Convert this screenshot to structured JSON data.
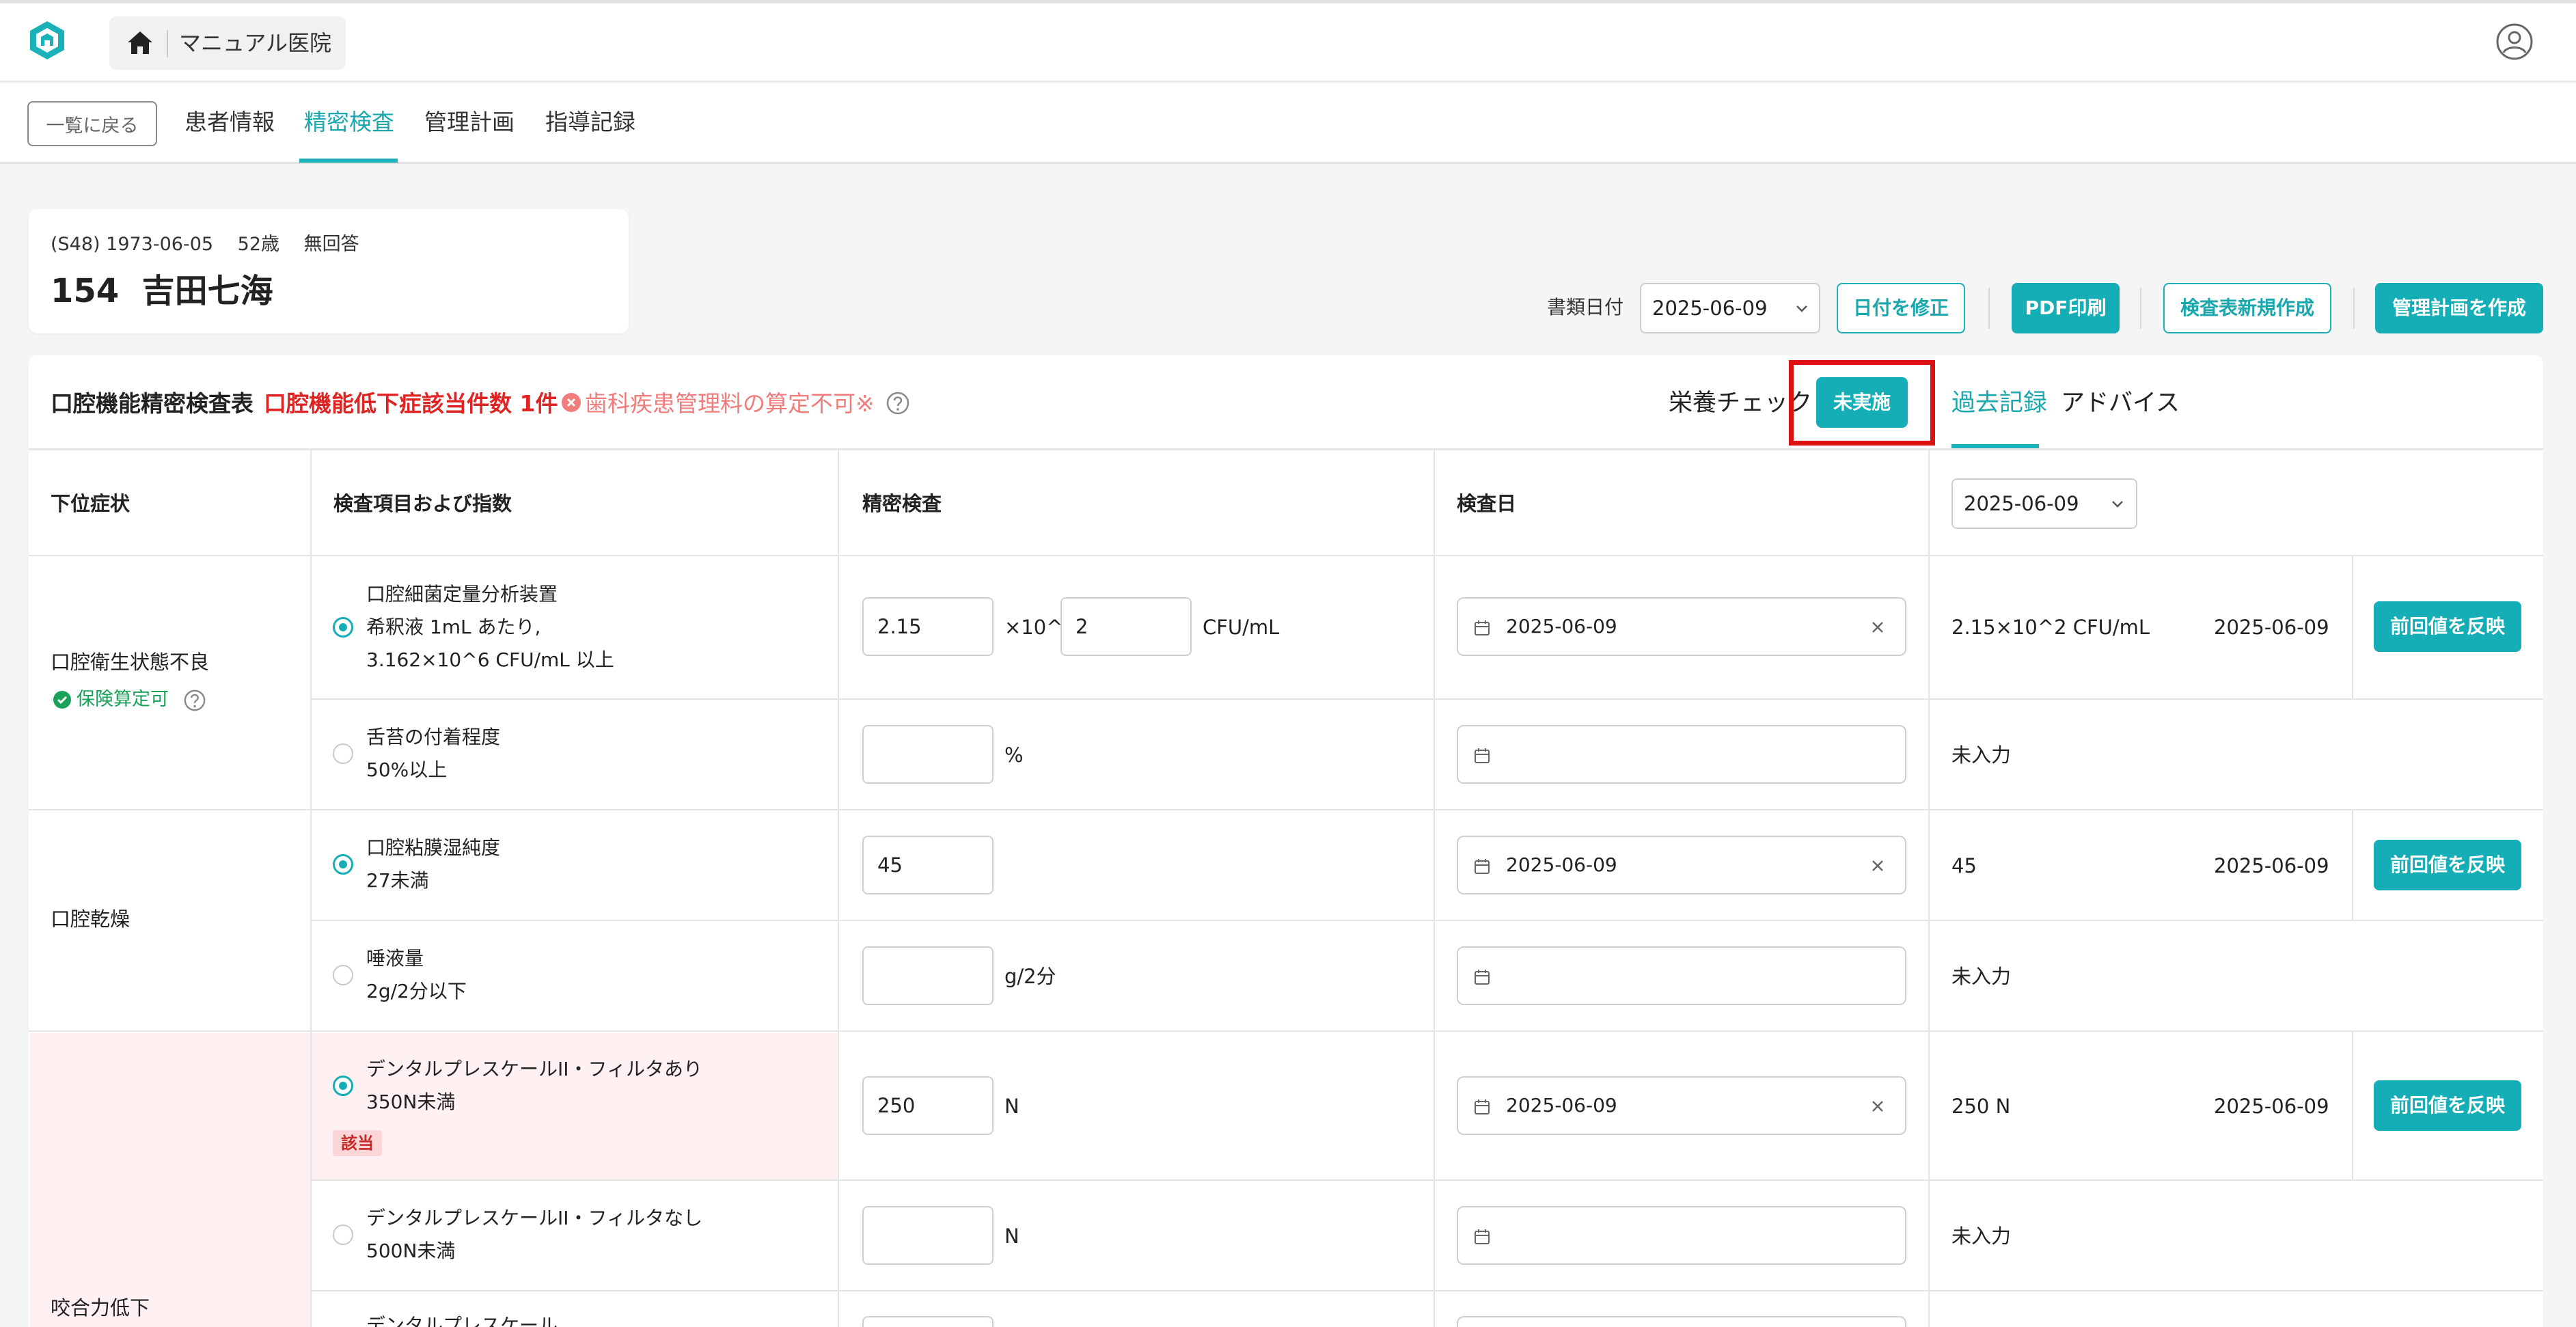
{
  "header": {
    "clinic_name": "マニュアル医院"
  },
  "nav": {
    "back_label": "一覧に戻る",
    "tabs": [
      {
        "label": "患者情報",
        "active": false
      },
      {
        "label": "精密検査",
        "active": true
      },
      {
        "label": "管理計画",
        "active": false
      },
      {
        "label": "指導記録",
        "active": false
      }
    ]
  },
  "patient": {
    "meta": "(S48) 1973-06-05　 52歳　 無回答",
    "id_name": "154  吉田七海"
  },
  "toolbar": {
    "doc_date_label": "書類日付",
    "doc_date": "2025-06-09",
    "fix_date_label": "日付を修正",
    "pdf_label": "PDF印刷",
    "new_sheet_label": "検査表新規作成",
    "create_plan_label": "管理計画を作成"
  },
  "sheet": {
    "title": "口腔機能精密検査表",
    "applicable_count": "口腔機能低下症該当件数 1件",
    "mgmt_error": "歯科疾患管理料の算定不可※",
    "nutrition_label": "栄養チェック",
    "nutrition_status": "未実施",
    "sub_tabs": [
      "過去記録",
      "アドバイス"
    ]
  },
  "table": {
    "headers": {
      "symptom": "下位症状",
      "item": "検査項目および指数",
      "exam": "精密検査",
      "exam_date": "検査日"
    },
    "compare_date": "2025-06-09",
    "apply_label": "前回値を反映",
    "not_entered": "未入力",
    "symptoms": [
      {
        "name": "口腔衛生状態不良",
        "insurance": "保険算定可"
      },
      {
        "name": "口腔乾燥"
      },
      {
        "name": "咬合力低下"
      }
    ],
    "rows": [
      {
        "selected": true,
        "lines": [
          "口腔細菌定量分析装置",
          "希釈液 1mL あたり,",
          "3.162×10^6 CFU/mL 以上"
        ],
        "value": "2.15",
        "times_label": "×10^",
        "exponent": "2",
        "unit": "CFU/mL",
        "date": "2025-06-09",
        "prev_value": "2.15×10^2 CFU/mL",
        "prev_date": "2025-06-09"
      },
      {
        "selected": false,
        "lines": [
          "舌苔の付着程度",
          "50%以上"
        ],
        "value": "",
        "unit": "%",
        "date": ""
      },
      {
        "selected": true,
        "lines": [
          "口腔粘膜湿純度",
          "27未満"
        ],
        "value": "45",
        "unit": "",
        "date": "2025-06-09",
        "prev_value": "45",
        "prev_date": "2025-06-09"
      },
      {
        "selected": false,
        "lines": [
          "唾液量",
          "2g/2分以下"
        ],
        "value": "",
        "unit": "g/2分",
        "date": ""
      },
      {
        "selected": true,
        "lines": [
          "デンタルプレスケールII・フィルタあり",
          "350N未満"
        ],
        "badge": "該当",
        "value": "250",
        "unit": "N",
        "date": "2025-06-09",
        "prev_value": "250 N",
        "prev_date": "2025-06-09"
      },
      {
        "selected": false,
        "lines": [
          "デンタルプレスケールII・フィルタなし",
          "500N未満"
        ],
        "value": "",
        "unit": "N",
        "date": ""
      },
      {
        "selected": false,
        "lines": [
          "デンタルプレスケール"
        ],
        "value": "",
        "unit": "",
        "date": ""
      }
    ]
  },
  "colors": {
    "accent": "#16aeb6",
    "danger": "#e02424",
    "error_soft": "#f07c7c",
    "ok": "#1aa25a",
    "row_highlight": "#fff1f1",
    "highlight_box": "#dd1111"
  }
}
